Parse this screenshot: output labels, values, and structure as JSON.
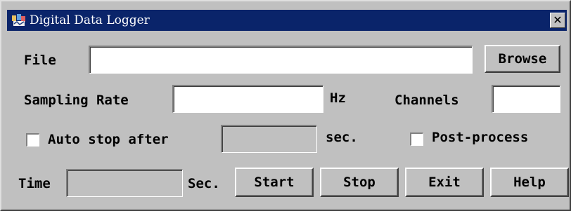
{
  "window": {
    "title": "Digital Data Logger",
    "close_glyph": "✕"
  },
  "file": {
    "label": "File",
    "value": "",
    "browse_label": "Browse"
  },
  "sampling": {
    "rate_label": "Sampling Rate",
    "rate_value": "",
    "rate_unit": "Hz",
    "channels_label": "Channels",
    "channels_value": ""
  },
  "auto_stop": {
    "label": "Auto stop after",
    "checked": false,
    "value": "",
    "unit": "sec."
  },
  "post_process": {
    "label": "Post-process",
    "checked": false
  },
  "time": {
    "label": "Time",
    "value": "",
    "unit": "Sec."
  },
  "buttons": {
    "start": "Start",
    "stop": "Stop",
    "exit": "Exit",
    "help": "Help"
  },
  "icons": {
    "app": "data-logger-app-icon",
    "close": "close-icon"
  }
}
